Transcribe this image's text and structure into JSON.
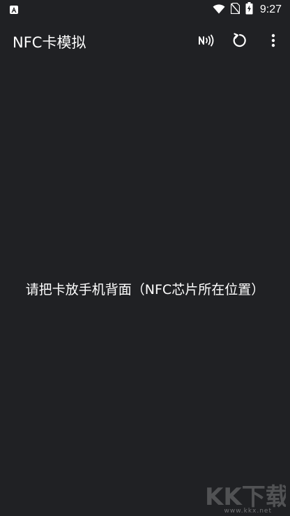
{
  "status_bar": {
    "time": "9:27",
    "icons": [
      "notification-a-icon",
      "wifi-icon",
      "no-sim-icon",
      "battery-charging-icon"
    ]
  },
  "app_bar": {
    "title": "NFC卡模拟",
    "actions": [
      {
        "name": "nfc-icon"
      },
      {
        "name": "refresh-icon"
      },
      {
        "name": "more-vert-icon"
      }
    ]
  },
  "main": {
    "message": "请把卡放手机背面（NFC芯片所在位置）"
  },
  "watermark": {
    "logo_text": "KK下载",
    "url": "www.kkx.net"
  },
  "colors": {
    "background": "#202124",
    "foreground": "#ffffff"
  }
}
